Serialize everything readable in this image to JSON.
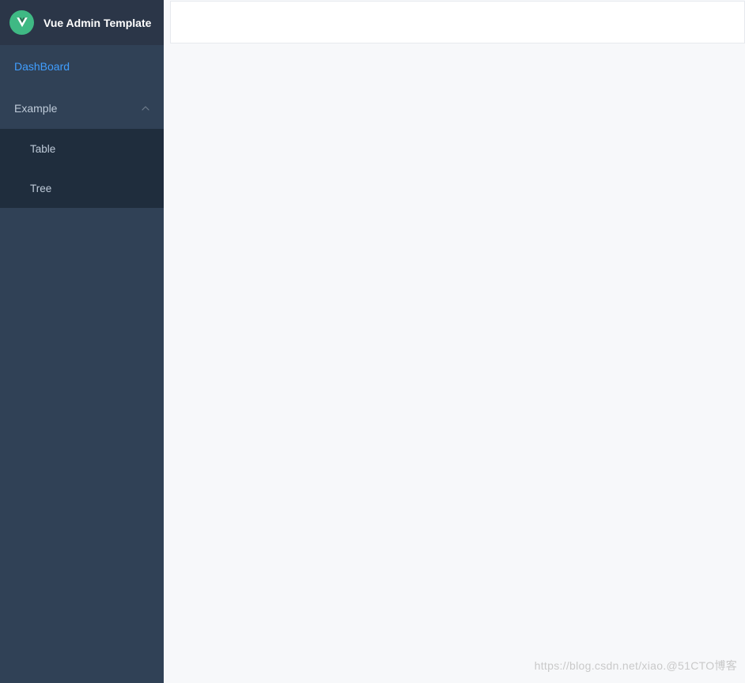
{
  "app": {
    "title": "Vue Admin Template",
    "logo_letter": "V"
  },
  "sidebar": {
    "items": [
      {
        "label": "DashBoard",
        "active": true
      },
      {
        "label": "Example",
        "expanded": true,
        "children": [
          {
            "label": "Table"
          },
          {
            "label": "Tree"
          }
        ]
      }
    ]
  },
  "watermark": {
    "left": "https://blog.csdn.net/xiao.",
    "right": "@51CTO博客"
  },
  "colors": {
    "sidebar_bg": "#304156",
    "sidebar_header_bg": "#2b3648",
    "submenu_bg": "#1f2d3d",
    "accent": "#409eff",
    "logo_bg": "#3fb984"
  }
}
